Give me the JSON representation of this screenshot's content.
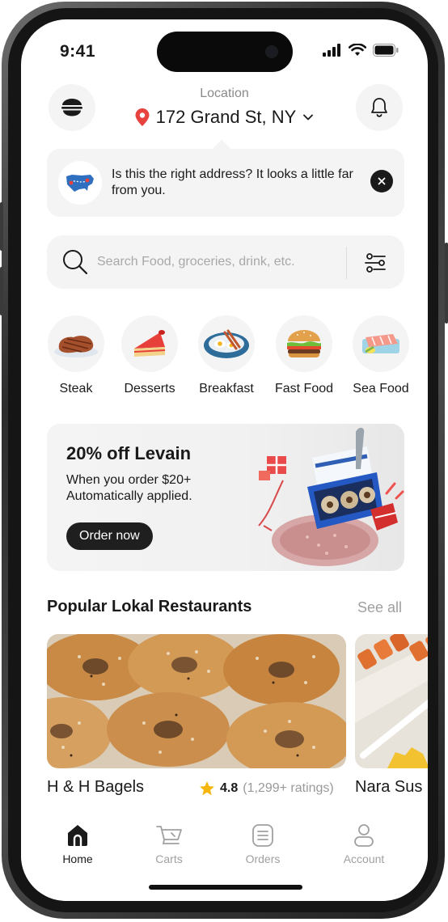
{
  "status_bar": {
    "time": "9:41"
  },
  "header": {
    "location_label": "Location",
    "address": "172 Grand St, NY"
  },
  "address_banner": {
    "message": "Is this the right address? It looks a little far from you."
  },
  "search": {
    "placeholder": "Search Food, groceries, drink, etc."
  },
  "categories": [
    {
      "label": "Steak",
      "icon": "steak-icon"
    },
    {
      "label": "Desserts",
      "icon": "cake-icon"
    },
    {
      "label": "Breakfast",
      "icon": "breakfast-icon"
    },
    {
      "label": "Fast Food",
      "icon": "burger-icon"
    },
    {
      "label": "Sea Food",
      "icon": "fish-icon"
    }
  ],
  "promo": {
    "title": "20% off Levain",
    "subtitle": "When you order $20+ Automatically applied.",
    "button_label": "Order now"
  },
  "popular": {
    "title": "Popular Lokal Restaurants",
    "see_all_label": "See all",
    "restaurants": [
      {
        "name": "H & H Bagels",
        "rating": "4.8",
        "ratings_count": "(1,299+ ratings)"
      },
      {
        "name": "Nara Sus"
      }
    ]
  },
  "tabs": [
    {
      "label": "Home",
      "icon": "home-icon",
      "active": true
    },
    {
      "label": "Carts",
      "icon": "cart-icon",
      "active": false
    },
    {
      "label": "Orders",
      "icon": "orders-icon",
      "active": false
    },
    {
      "label": "Account",
      "icon": "account-icon",
      "active": false
    }
  ],
  "colors": {
    "accent_red": "#e8423f",
    "dark": "#1f1f1f",
    "muted_text": "#a0a0a0",
    "surface": "#f4f4f4",
    "rating_star": "#f5b50a"
  }
}
